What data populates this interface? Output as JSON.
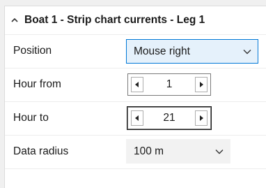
{
  "section": {
    "title": "Boat 1 - Strip chart currents - Leg 1",
    "collapse_icon": "chevron-up-icon"
  },
  "fields": {
    "position": {
      "label": "Position",
      "value": "Mouse right"
    },
    "hour_from": {
      "label": "Hour from",
      "value": "1"
    },
    "hour_to": {
      "label": "Hour to",
      "value": "21"
    },
    "data_radius": {
      "label": "Data radius",
      "value": "100 m"
    }
  },
  "colors": {
    "accent": "#0078d7",
    "active_fill": "#e5f1fb"
  }
}
